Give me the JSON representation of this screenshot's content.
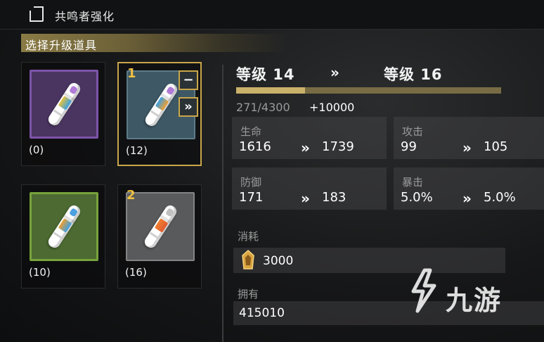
{
  "header": {
    "title": "共鸣者强化",
    "icon": "document-icon"
  },
  "section": {
    "label": "选择升级道具"
  },
  "items": [
    {
      "count": "(0)",
      "rarity": "purple",
      "tip_color": "#b07ad6",
      "band_color": "#e6c23a"
    },
    {
      "count": "(12)",
      "rarity": "blue",
      "selected_num": "1",
      "tip_color": "#b07ad6",
      "band_color": "#3aa0e6"
    },
    {
      "count": "(10)",
      "rarity": "green",
      "tip_color": "#4aa0e0",
      "band_color": "#f0a030"
    },
    {
      "count": "(16)",
      "rarity": "gray",
      "selected_num": "2",
      "tip_color": "#c0c0c0",
      "band_color": "#f08030"
    }
  ],
  "controls": {
    "minus": "−",
    "max": "»"
  },
  "level": {
    "current": "等级 14",
    "target": "等级 16",
    "arrow": "»"
  },
  "exp": {
    "progress": "271/4300",
    "gain": "+10000",
    "fill_fraction": 0.26
  },
  "stats": [
    {
      "label": "生命",
      "from": "1616",
      "to": "1739"
    },
    {
      "label": "攻击",
      "from": "99",
      "to": "105"
    },
    {
      "label": "防御",
      "from": "171",
      "to": "183"
    },
    {
      "label": "暴击",
      "from": "5.0%",
      "to": "5.0%"
    }
  ],
  "cost": {
    "label": "消耗",
    "value": "3000",
    "icon": "shell-credit-icon"
  },
  "owned": {
    "label": "拥有",
    "value": "415010"
  },
  "watermark": {
    "text": "九游"
  },
  "colors": {
    "accent_gold": "#c9a649",
    "bar_fill": "#c9b16a"
  }
}
